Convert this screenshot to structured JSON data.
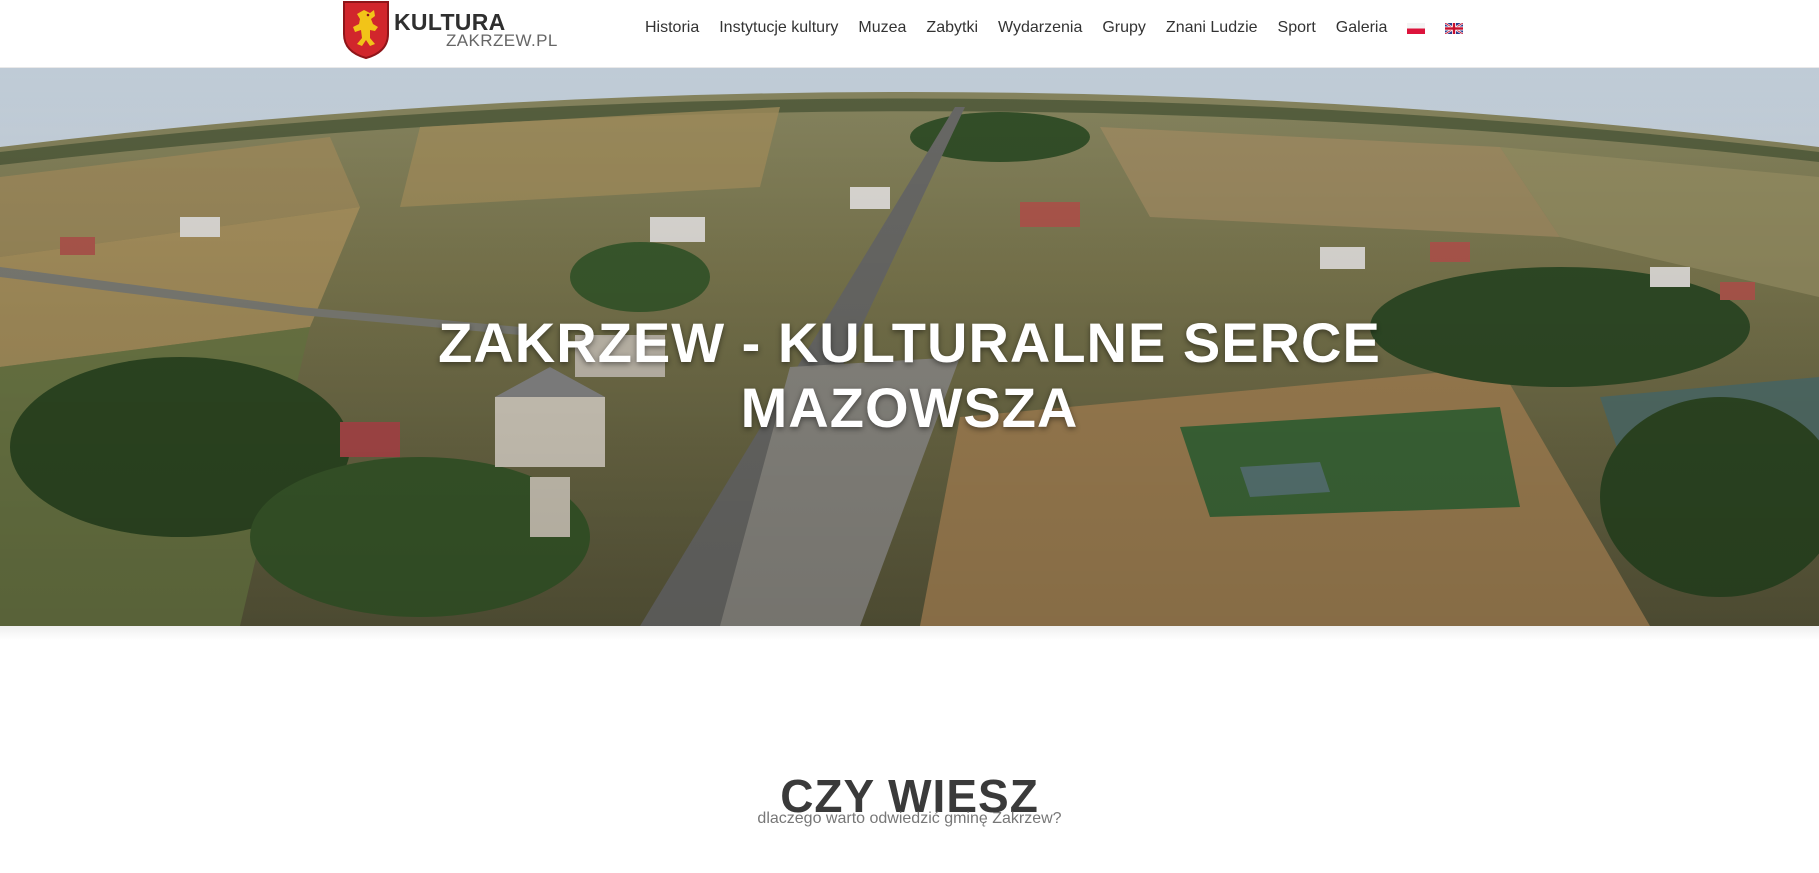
{
  "header": {
    "logo": {
      "main": "KULTURA",
      "sub": "ZAKRZEW.PL"
    },
    "nav": [
      {
        "label": "Historia"
      },
      {
        "label": "Instytucje kultury"
      },
      {
        "label": "Muzea"
      },
      {
        "label": "Zabytki"
      },
      {
        "label": "Wydarzenia"
      },
      {
        "label": "Grupy"
      },
      {
        "label": "Znani Ludzie"
      },
      {
        "label": "Sport"
      },
      {
        "label": "Galeria"
      }
    ],
    "languages": [
      {
        "icon": "polish-flag-icon"
      },
      {
        "icon": "english-flag-icon"
      }
    ]
  },
  "hero": {
    "title_line1": "ZAKRZEW - KULTURALNE SERCE",
    "title_line2": "MAZOWSZA",
    "image": "aerial-village-photo"
  },
  "section": {
    "title": "CZY WIESZ",
    "subtitle": "dlaczego warto odwiedzić gminę Zakrzew?"
  },
  "colors": {
    "crest_red": "#d1262c",
    "crest_gold": "#f2c418",
    "text_dark": "#333333",
    "text_muted": "#777777"
  }
}
